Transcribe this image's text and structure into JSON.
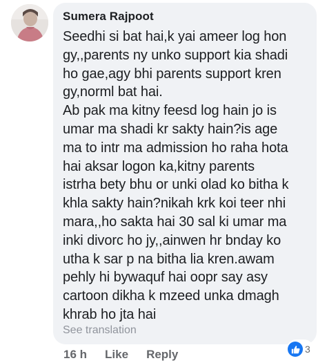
{
  "comment": {
    "author": "Sumera Rajpoot",
    "text": "Seedhi si bat hai,k yai ameer log hon\ngy,,parents ny unko support kia shadi\nho gae,agy bhi parents support kren\ngy,norml bat hai.\nAb pak ma kitny feesd log hain jo is\numar ma shadi kr sakty hain?is age\nma to intr ma admission ho raha hota\nhai aksar logon ka,kitny parents\nistrha bety bhu or unki olad ko bitha k\nkhla sakty hain?nikah krk koi teer nhi\nmara,,ho sakta hai 30 sal ki umar ma\ninki divorc ho jy,,ainwen hr bnday ko\nutha k sar p na bitha lia kren.awam\npehly hi bywaquf hai oopr say asy\ncartoon dikha k mzeed unka dmagh\nkhrab ho jta hai",
    "translation_link": "See translation",
    "reaction_count": "3",
    "reaction_icon": "thumbs-up-icon"
  },
  "actions": {
    "time": "16 h",
    "like": "Like",
    "reply": "Reply"
  },
  "colors": {
    "bubble": "#f0f2f5",
    "like_blue": "#1877f2",
    "muted_text": "#65676b"
  }
}
